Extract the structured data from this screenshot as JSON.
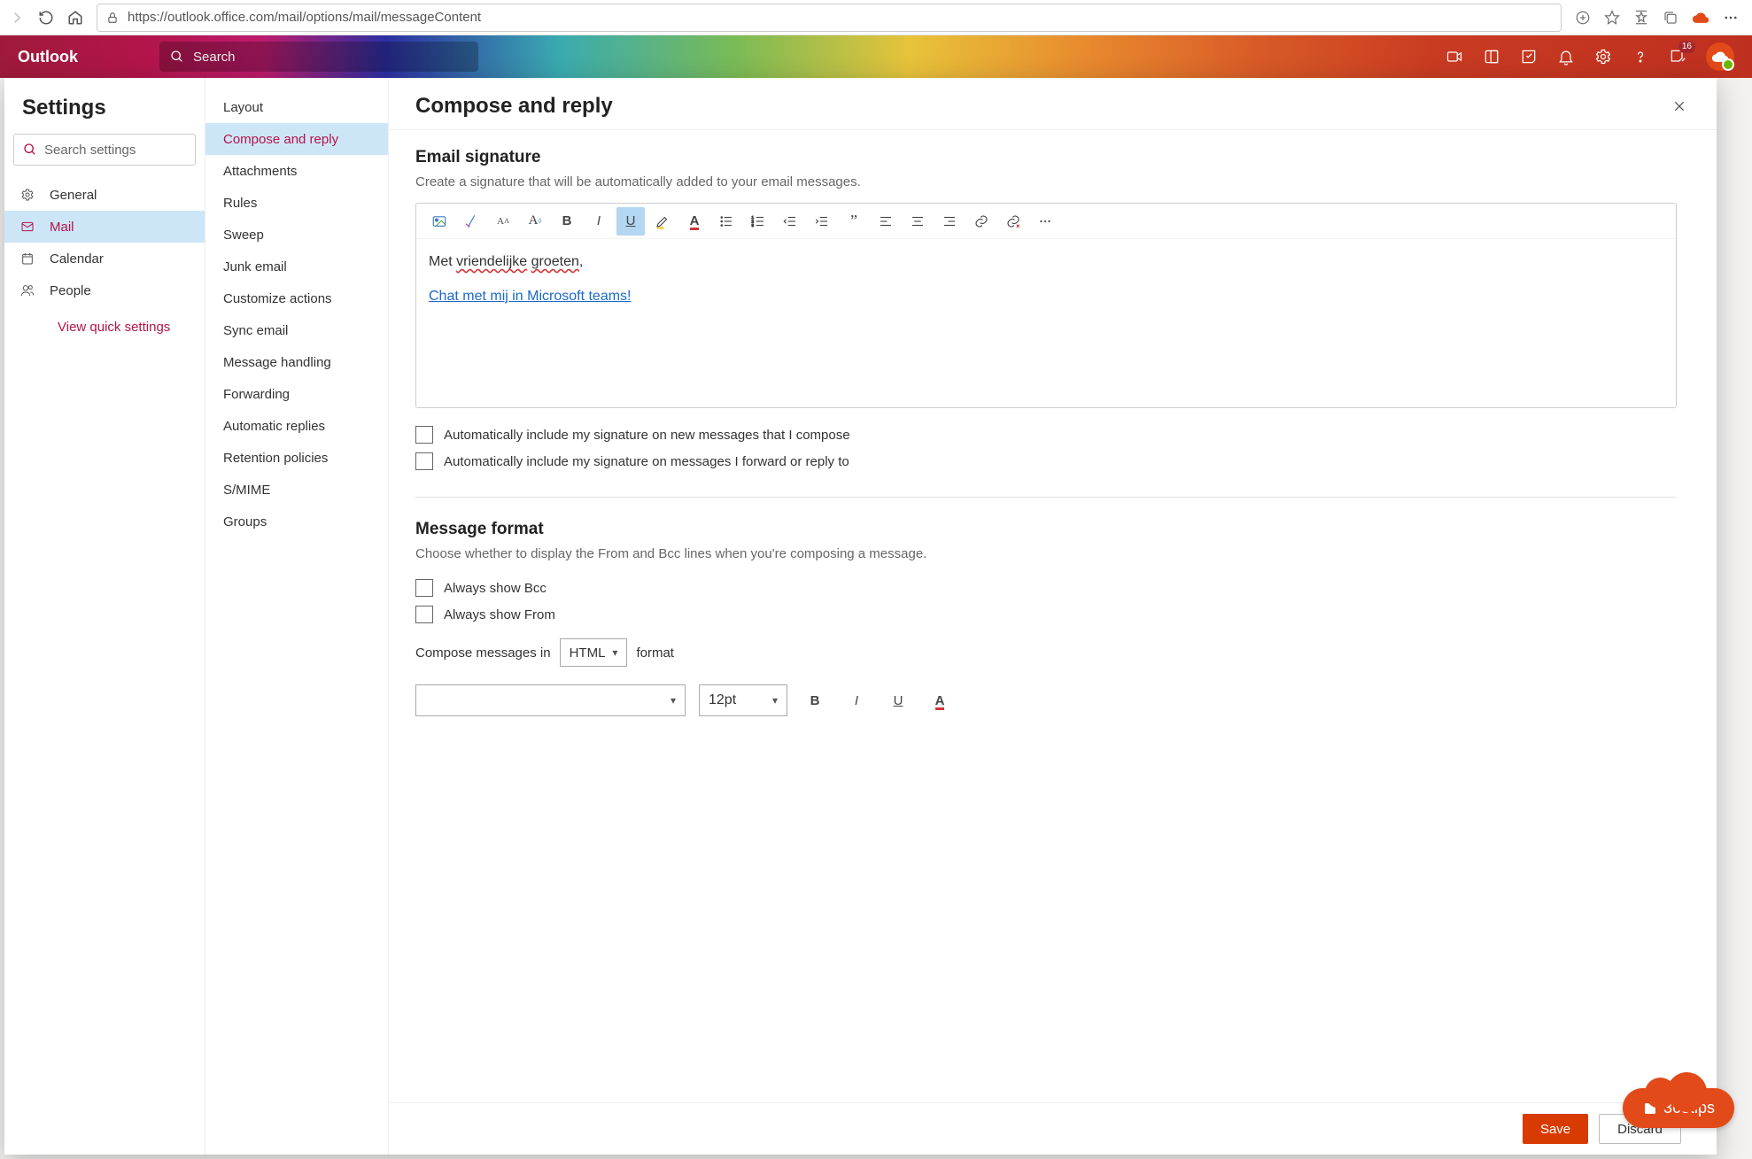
{
  "browser": {
    "url": "https://outlook.office.com/mail/options/mail/messageContent"
  },
  "header": {
    "app_name": "Outlook",
    "search_placeholder": "Search",
    "badge_count": "16"
  },
  "settings": {
    "title": "Settings",
    "search_placeholder": "Search settings",
    "categories": [
      {
        "icon": "gear",
        "label": "General"
      },
      {
        "icon": "mail",
        "label": "Mail",
        "selected": true
      },
      {
        "icon": "calendar",
        "label": "Calendar"
      },
      {
        "icon": "people",
        "label": "People"
      }
    ],
    "view_quick": "View quick settings",
    "subcategories": [
      "Layout",
      "Compose and reply",
      "Attachments",
      "Rules",
      "Sweep",
      "Junk email",
      "Customize actions",
      "Sync email",
      "Message handling",
      "Forwarding",
      "Automatic replies",
      "Retention policies",
      "S/MIME",
      "Groups"
    ],
    "selected_subcategory_index": 1
  },
  "main": {
    "title": "Compose and reply",
    "signature": {
      "heading": "Email signature",
      "description": "Create a signature that will be automatically added to your email messages.",
      "line1_prefix": "Met ",
      "line1_word1": "vriendelijke",
      "line1_word2": "groeten",
      "line1_suffix": ",",
      "link_text": "Chat met mij in Microsoft teams!",
      "chk_new": "Automatically include my signature on new messages that I compose",
      "chk_reply": "Automatically include my signature on messages I forward or reply to"
    },
    "format": {
      "heading": "Message format",
      "description": "Choose whether to display the From and Bcc lines when you're composing a message.",
      "chk_bcc": "Always show Bcc",
      "chk_from": "Always show From",
      "compose_prefix": "Compose messages in",
      "compose_select": "HTML",
      "compose_suffix": "format",
      "font_family": "",
      "font_size": "12pt"
    },
    "buttons": {
      "save": "Save",
      "discard": "Discard"
    }
  },
  "watermark": "365tips"
}
